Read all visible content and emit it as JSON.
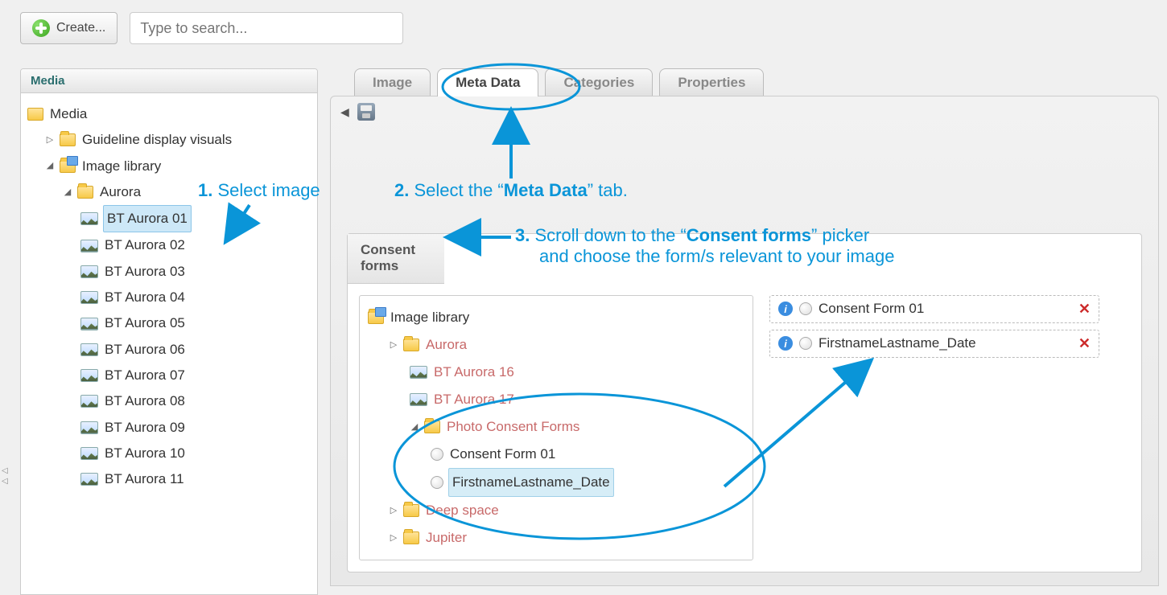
{
  "toolbar": {
    "create_label": "Create...",
    "search_placeholder": "Type to search..."
  },
  "sidebar": {
    "title": "Media",
    "root": "Media",
    "items": {
      "guideline": "Guideline display visuals",
      "imagelib": "Image library",
      "aurora": "Aurora",
      "bt": [
        "BT Aurora 01",
        "BT Aurora 02",
        "BT Aurora 03",
        "BT Aurora 04",
        "BT Aurora 05",
        "BT Aurora 06",
        "BT Aurora 07",
        "BT Aurora 08",
        "BT Aurora 09",
        "BT Aurora 10",
        "BT Aurora 11"
      ]
    }
  },
  "tabs": {
    "image": "Image",
    "meta": "Meta Data",
    "categories": "Categories",
    "properties": "Properties"
  },
  "panel": {
    "title": "Consent forms",
    "tree": {
      "root": "Image library",
      "aurora": "Aurora",
      "bt16": "BT Aurora 16",
      "bt17": "BT Aurora 17",
      "pcf": "Photo Consent Forms",
      "cf01": "Consent Form 01",
      "fld": "FirstnameLastname_Date",
      "deep": "Deep space",
      "jupiter": "Jupiter"
    },
    "selected": [
      {
        "label": "Consent Form 01"
      },
      {
        "label": "FirstnameLastname_Date"
      }
    ]
  },
  "annotations": {
    "a1_num": "1.",
    "a1_text": "Select image",
    "a2_num": "2.",
    "a2_pre": "Select the “",
    "a2_bold": "Meta Data",
    "a2_post": "” tab.",
    "a3_num": "3.",
    "a3_pre": "Scroll down to the “",
    "a3_bold": "Consent forms",
    "a3_post": "” picker",
    "a3_line2": "and choose the form/s relevant to your image"
  }
}
